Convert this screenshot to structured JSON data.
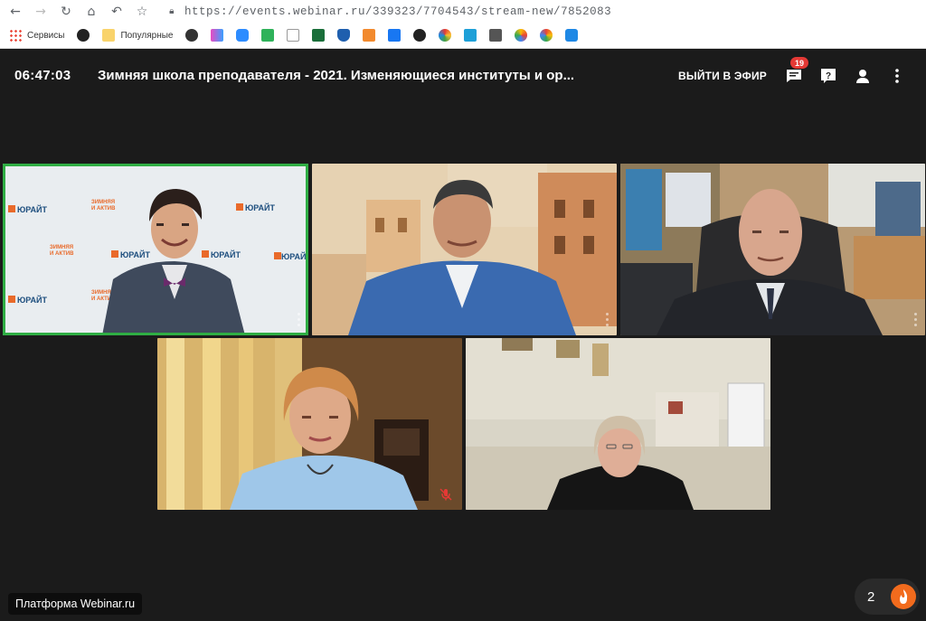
{
  "browser": {
    "url": "https://events.webinar.ru/339323/7704543/stream-new/7852083",
    "bookmarks": [
      {
        "label": "Сервисы",
        "icon": "apps-grid-icon"
      },
      {
        "label": "",
        "icon": "globe-icon"
      },
      {
        "label": "Популярные",
        "icon": "folder-icon"
      }
    ]
  },
  "header": {
    "time": "06:47:03",
    "title": "Зимняя школа преподавателя - 2021. Изменяющиеся институты и ор...",
    "go_live_label": "ВЫЙТИ В ЭФИР",
    "chat_badge": "19"
  },
  "tiles": [
    {
      "name": "participant-1",
      "active": true,
      "banner_text": "ЮРАЙТ",
      "banner_sub": "ЗИМНЯЯ ШКОЛА"
    },
    {
      "name": "participant-2",
      "active": false
    },
    {
      "name": "participant-3",
      "active": false
    },
    {
      "name": "participant-4",
      "active": false,
      "muted": true
    },
    {
      "name": "participant-5",
      "active": false
    }
  ],
  "footer": {
    "platform_label": "Платформа Webinar.ru",
    "viewers_count": "2"
  },
  "colors": {
    "active_border": "#2fae44",
    "badge": "#e53935",
    "flame": "#f26b1d"
  }
}
